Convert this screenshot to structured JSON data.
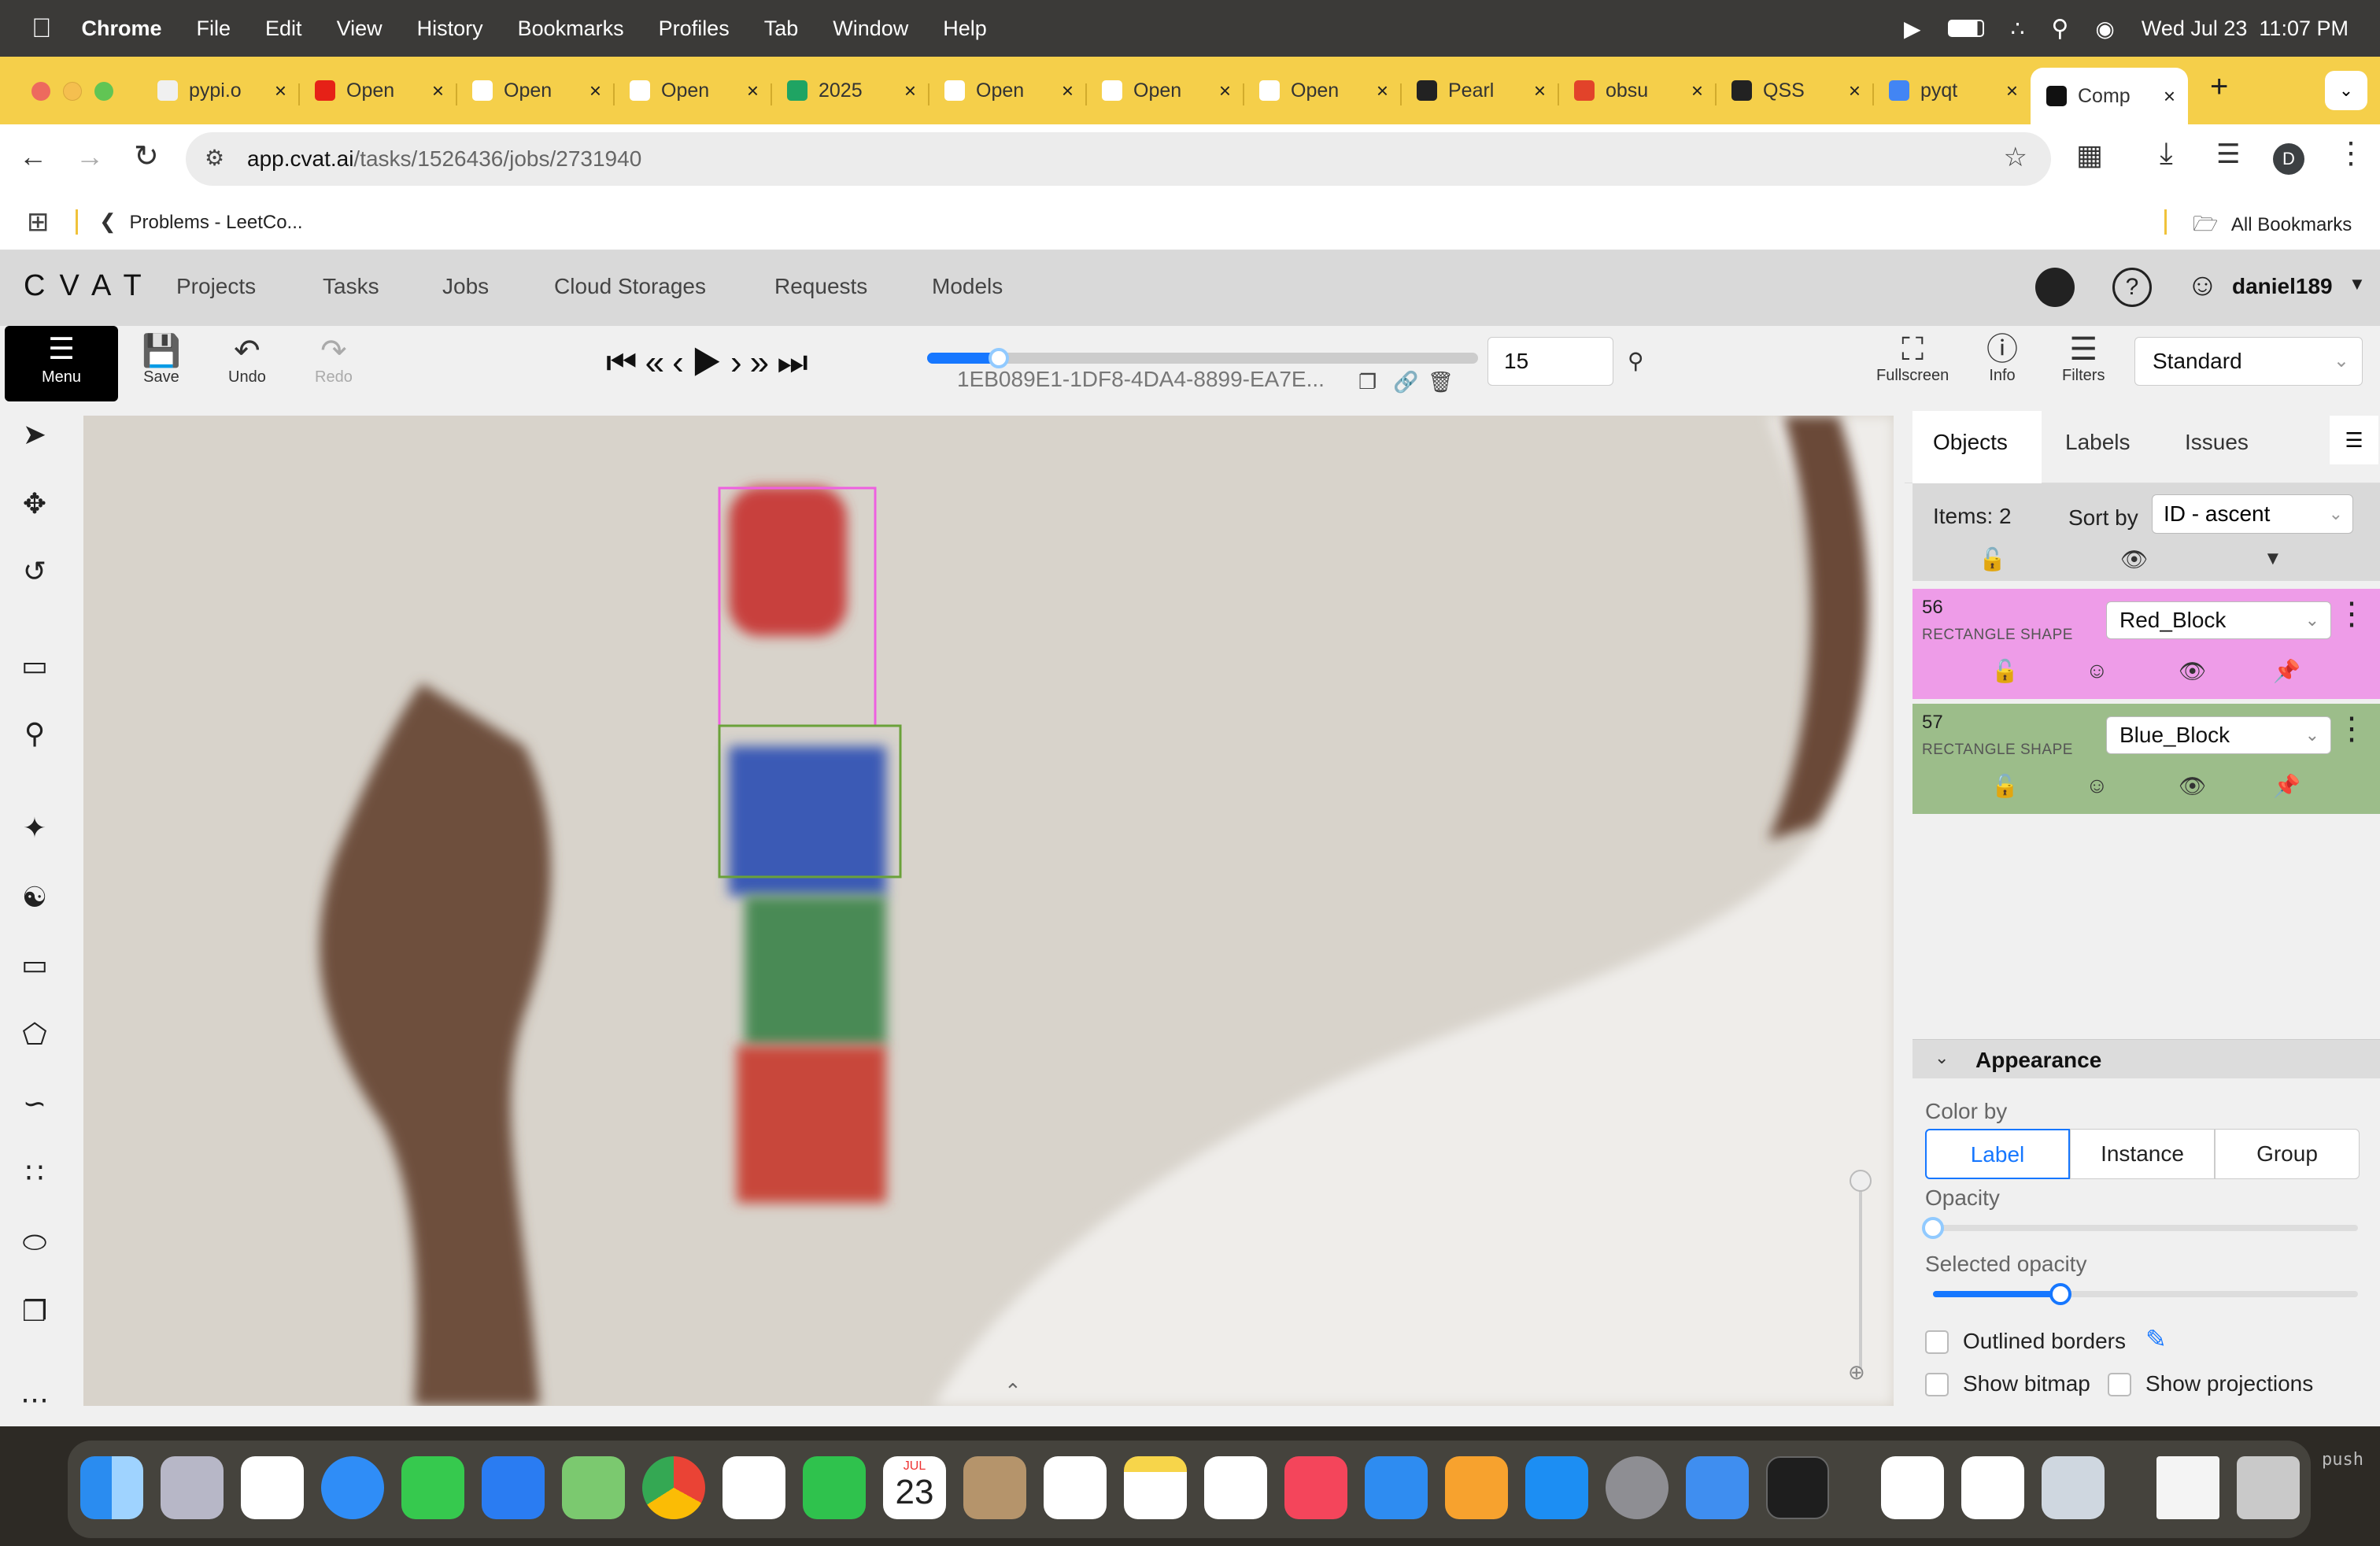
{
  "macos": {
    "app_name": "Chrome",
    "menu": [
      "File",
      "Edit",
      "View",
      "History",
      "Bookmarks",
      "Profiles",
      "Tab",
      "Window",
      "Help"
    ],
    "datetime": "Wed Jul 23  11:07 PM"
  },
  "browser": {
    "tabs": [
      {
        "label": "pypi.o",
        "fav_color": "#f0f0f0"
      },
      {
        "label": "Open",
        "fav_color": "#e62117"
      },
      {
        "label": "Open",
        "fav_color": "#ffffff"
      },
      {
        "label": "Open",
        "fav_color": "#ffffff"
      },
      {
        "label": "2025",
        "fav_color": "#1fa463"
      },
      {
        "label": "Open",
        "fav_color": "#ffffff"
      },
      {
        "label": "Open",
        "fav_color": "#ffffff"
      },
      {
        "label": "Open",
        "fav_color": "#ffffff"
      },
      {
        "label": "Pearl",
        "fav_color": "#222222"
      },
      {
        "label": "obsu",
        "fav_color": "#e2432a"
      },
      {
        "label": "QSS",
        "fav_color": "#222222"
      },
      {
        "label": "pyqt",
        "fav_color": "#4285f4"
      },
      {
        "label": "Comp",
        "fav_color": "#111111"
      }
    ],
    "new_tab": "+",
    "url_domain": "app.cvat.ai",
    "url_path": "/tasks/1526436/jobs/2731940",
    "profile_initial": "D",
    "bookmark_leetcode": "Problems - LeetCo...",
    "all_bookmarks": "All Bookmarks"
  },
  "cvat": {
    "logo": "CVAT",
    "nav": [
      "Projects",
      "Tasks",
      "Jobs",
      "Cloud Storages",
      "Requests",
      "Models"
    ],
    "username": "daniel189",
    "toolbar": {
      "menu": "Menu",
      "save": "Save",
      "undo": "Undo",
      "redo": "Redo",
      "frame_name": "1EB089E1-1DF8-4DA4-8899-EA7E...",
      "frame_number": "15",
      "fullscreen": "Fullscreen",
      "info": "Info",
      "filters": "Filters",
      "workspace": "Standard"
    },
    "frame_progress": 0.13,
    "right_panel": {
      "tabs": [
        "Objects",
        "Labels",
        "Issues"
      ],
      "items_count": "Items: 2",
      "sort_label": "Sort by",
      "sort_value": "ID - ascent",
      "objects": [
        {
          "id": "56",
          "kind": "RECTANGLE SHAPE",
          "label": "Red_Block",
          "color": "#ee9ce8"
        },
        {
          "id": "57",
          "kind": "RECTANGLE SHAPE",
          "label": "Blue_Block",
          "color": "#9cbd8a"
        }
      ],
      "appearance": {
        "title": "Appearance",
        "color_by": "Color by",
        "options": [
          "Label",
          "Instance",
          "Group"
        ],
        "selected_option": "Label",
        "opacity_label": "Opacity",
        "opacity_value": 0,
        "selected_opacity_label": "Selected opacity",
        "selected_opacity_value": 0.3,
        "outlined_borders": "Outlined borders",
        "show_bitmap": "Show bitmap",
        "show_projections": "Show projections"
      }
    }
  },
  "dock": {
    "calendar_month": "JUL",
    "calendar_day": "23",
    "terminal_text": "push"
  }
}
